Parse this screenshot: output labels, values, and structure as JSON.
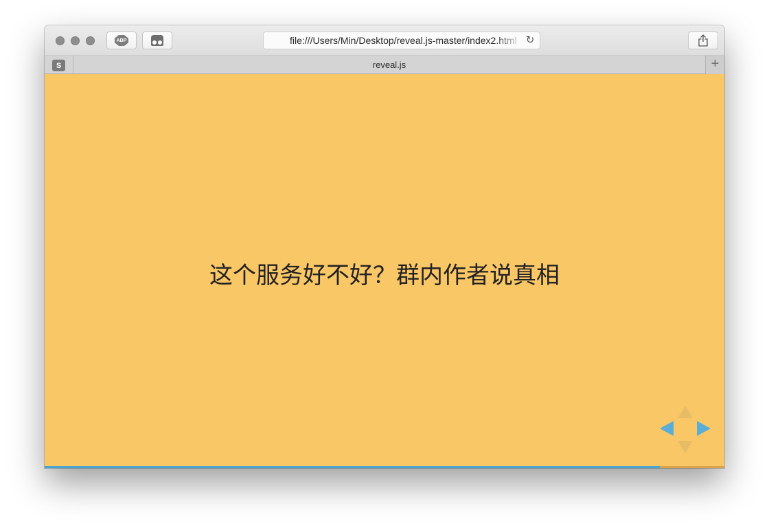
{
  "browser": {
    "url": "file:///Users/Min/Desktop/reveal.js-master/index2.html",
    "abp_label": "ABP",
    "reload_glyph": "↻",
    "share_icon": "share-icon"
  },
  "tab": {
    "favicon_letter": "S",
    "title": "reveal.js",
    "new_tab_glyph": "+"
  },
  "slide": {
    "title": "这个服务好不好？群内作者说真相",
    "background": "#fac766",
    "progress": 0.905,
    "accent": "#42a5d5"
  },
  "controls": {
    "left_enabled": true,
    "right_enabled": true,
    "up_enabled": false,
    "down_enabled": false
  }
}
